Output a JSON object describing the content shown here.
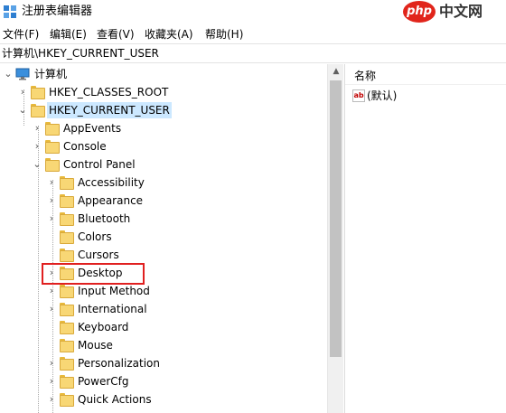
{
  "window": {
    "title": "注册表编辑器",
    "icon": "registry-editor-icon"
  },
  "watermark": {
    "logo": "php",
    "text": "中文网"
  },
  "menu": [
    {
      "label": "文件(F)"
    },
    {
      "label": "编辑(E)"
    },
    {
      "label": "查看(V)"
    },
    {
      "label": "收藏夹(A)"
    },
    {
      "label": "帮助(H)"
    }
  ],
  "address": {
    "path": "计算机\\HKEY_CURRENT_USER"
  },
  "tree": {
    "root": "计算机",
    "nodes": [
      {
        "label": "HKEY_CLASSES_ROOT",
        "expand": "collapsed"
      },
      {
        "label": "HKEY_CURRENT_USER",
        "expand": "expanded",
        "selected": true
      },
      {
        "label": "AppEvents",
        "expand": "collapsed"
      },
      {
        "label": "Console",
        "expand": "collapsed"
      },
      {
        "label": "Control Panel",
        "expand": "expanded"
      },
      {
        "label": "Accessibility",
        "expand": "collapsed"
      },
      {
        "label": "Appearance",
        "expand": "collapsed"
      },
      {
        "label": "Bluetooth",
        "expand": "collapsed"
      },
      {
        "label": "Colors",
        "expand": "none"
      },
      {
        "label": "Cursors",
        "expand": "none"
      },
      {
        "label": "Desktop",
        "expand": "collapsed",
        "highlighted": true
      },
      {
        "label": "Input Method",
        "expand": "collapsed"
      },
      {
        "label": "International",
        "expand": "collapsed"
      },
      {
        "label": "Keyboard",
        "expand": "none"
      },
      {
        "label": "Mouse",
        "expand": "none"
      },
      {
        "label": "Personalization",
        "expand": "collapsed"
      },
      {
        "label": "PowerCfg",
        "expand": "collapsed"
      },
      {
        "label": "Quick Actions",
        "expand": "collapsed"
      }
    ]
  },
  "values_pane": {
    "column_header": "名称",
    "rows": [
      {
        "name": "(默认)",
        "icon": "string-value-icon"
      }
    ]
  },
  "colors": {
    "selection": "#cce8ff",
    "highlight_box": "#e02020",
    "folder": "#f8d775"
  }
}
